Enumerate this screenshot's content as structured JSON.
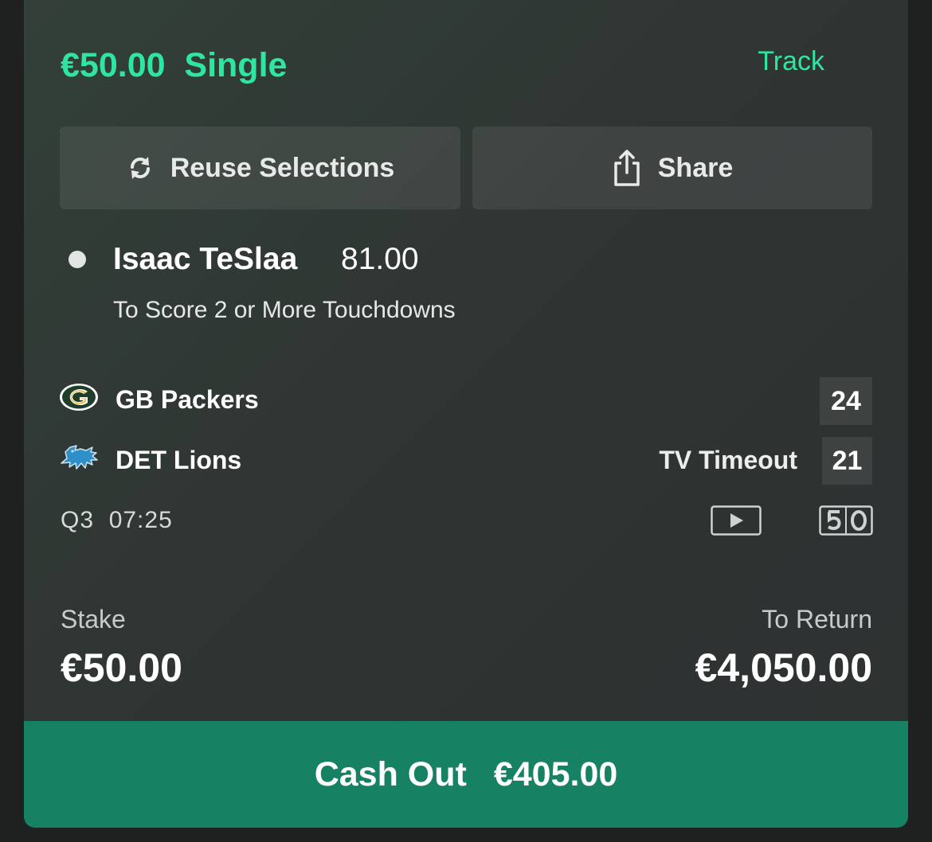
{
  "bet": {
    "header": "€50.00  Single",
    "track_label": "Track"
  },
  "actions": {
    "reuse_label": "Reuse Selections",
    "share_label": "Share"
  },
  "selection": {
    "name": "Isaac TeSlaa",
    "odds": "81.00",
    "market": "To Score 2 or More Touchdowns"
  },
  "match": {
    "home": {
      "name": "GB Packers",
      "score": "24",
      "logo_icon": "packers-logo-icon"
    },
    "away": {
      "name": "DET Lions",
      "score": "21",
      "logo_icon": "lions-logo-icon"
    },
    "status": "TV Timeout",
    "clock": "Q3  07:25",
    "icons": [
      "play-video-icon",
      "fifty-yard-tracker-icon"
    ]
  },
  "summary": {
    "stake_label": "Stake",
    "stake_value": "€50.00",
    "return_label": "To Return",
    "return_value": "€4,050.00"
  },
  "cashout": {
    "label": "Cash Out",
    "amount": "€405.00"
  },
  "colors": {
    "accent": "#2fe6a0",
    "cashout_bg": "#168263",
    "card_bg": "#2f3533",
    "page_bg": "#1f2020"
  }
}
